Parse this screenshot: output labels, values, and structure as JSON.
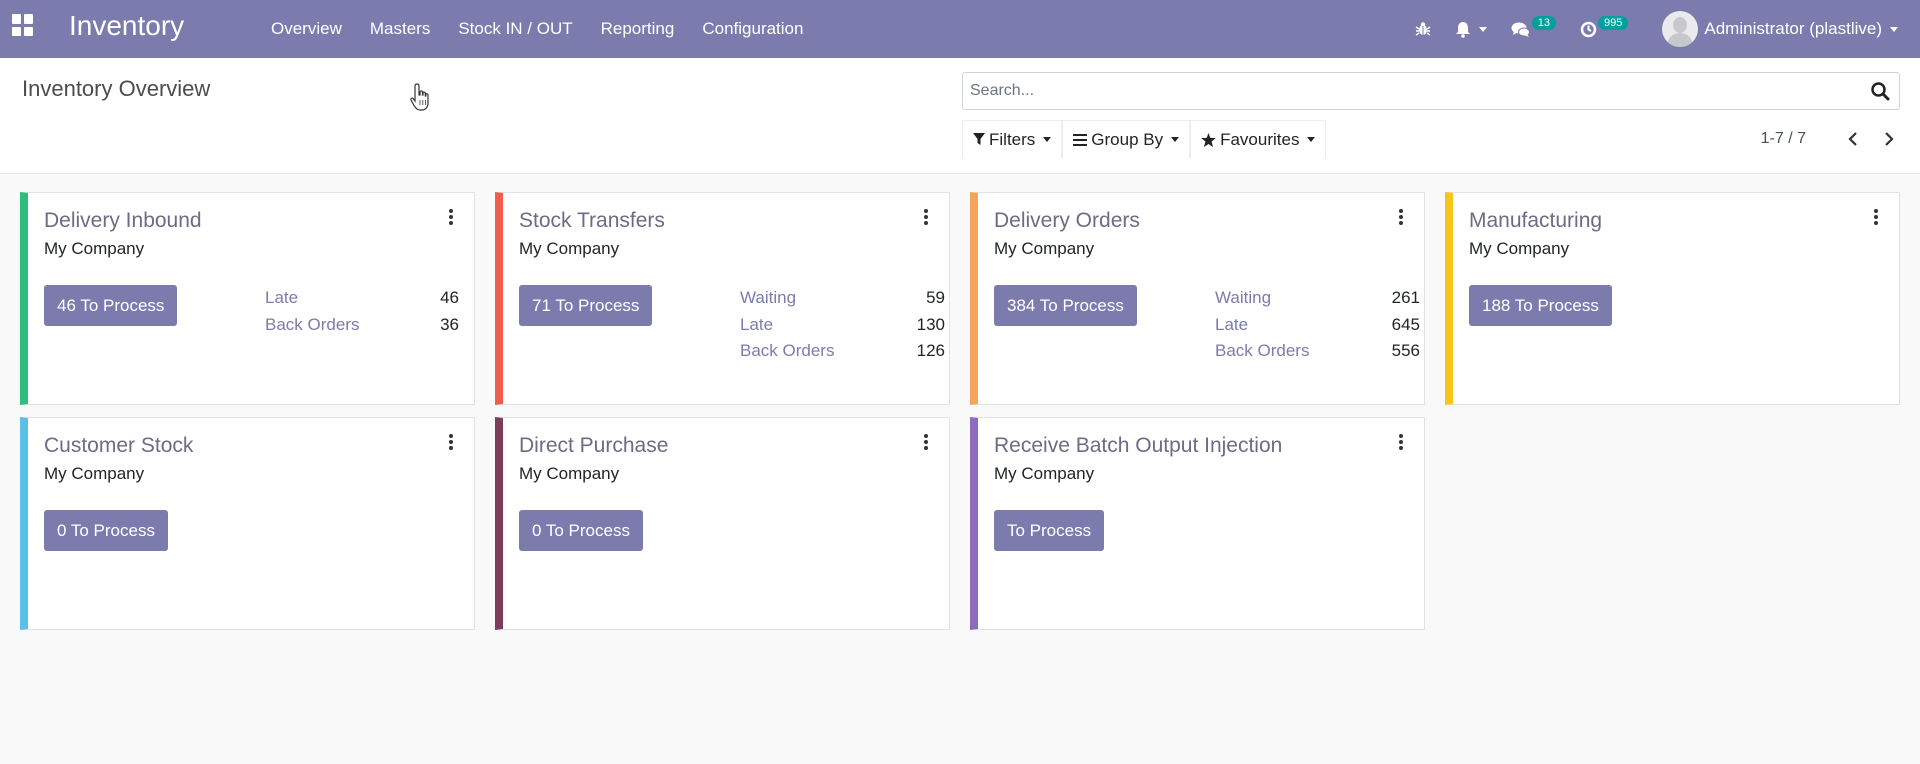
{
  "navbar": {
    "brand": "Inventory",
    "menu": [
      {
        "label": "Overview"
      },
      {
        "label": "Masters"
      },
      {
        "label": "Stock IN / OUT"
      },
      {
        "label": "Reporting"
      },
      {
        "label": "Configuration"
      }
    ],
    "systray": {
      "debug_icon": "bug-icon",
      "notifications_icon": "bell-icon",
      "messages_icon": "chat-icon",
      "messages_count": "13",
      "activity_icon": "clock-icon",
      "activity_count": "995",
      "user_name": "Administrator (plastlive)"
    },
    "colors": {
      "navbar_bg": "#7c7bad",
      "badge_bg": "#00a09d"
    }
  },
  "control_panel": {
    "title": "Inventory Overview",
    "search": {
      "placeholder": "Search...",
      "value": ""
    },
    "filters": [
      {
        "label": "Filters",
        "icon": "filter-icon"
      },
      {
        "label": "Group By",
        "icon": "list-icon"
      },
      {
        "label": "Favourites",
        "icon": "star-icon"
      }
    ],
    "pager": {
      "value": "1-7 / 7"
    }
  },
  "cards": [
    {
      "title": "Delivery Inbound",
      "company": "My Company",
      "button": "46 To Process",
      "color": "#2ebd7e",
      "stats": [
        {
          "label": "Late",
          "value": "46"
        },
        {
          "label": "Back Orders",
          "value": "36"
        }
      ]
    },
    {
      "title": "Stock Transfers",
      "company": "My Company",
      "button": "71 To Process",
      "color": "#f05d4d",
      "stats": [
        {
          "label": "Waiting",
          "value": "59"
        },
        {
          "label": "Late",
          "value": "130"
        },
        {
          "label": "Back Orders",
          "value": "126"
        }
      ]
    },
    {
      "title": "Delivery Orders",
      "company": "My Company",
      "button": "384 To Process",
      "color": "#f4a55b",
      "stats": [
        {
          "label": "Waiting",
          "value": "261"
        },
        {
          "label": "Late",
          "value": "645"
        },
        {
          "label": "Back Orders",
          "value": "556"
        }
      ]
    },
    {
      "title": "Manufacturing",
      "company": "My Company",
      "button": "188 To Process",
      "color": "#f5c518",
      "stats": []
    },
    {
      "title": "Customer Stock",
      "company": "My Company",
      "button": "0 To Process",
      "color": "#5bc0e8",
      "stats": []
    },
    {
      "title": "Direct Purchase",
      "company": "My Company",
      "button": "0 To Process",
      "color": "#7d3e5e",
      "stats": []
    },
    {
      "title": "Receive Batch Output Injection",
      "company": "My Company",
      "button": "To Process",
      "color": "#8e6bbf",
      "stats": []
    }
  ]
}
